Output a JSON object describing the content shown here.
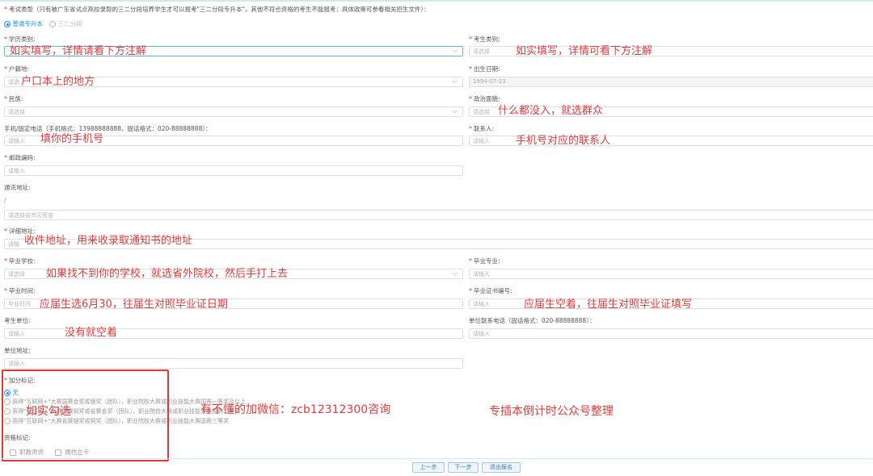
{
  "exam_type": {
    "label": "考试类型（只有被广东省试点高校录取的三二分段培养学生才可以报考\"三二分段专升本\"，其他不符合资格的考生不能报考：具体政策可参看相关招生文件）：",
    "options": [
      "普通专升本",
      "三二分段"
    ]
  },
  "fields": {
    "education_type": {
      "label": "学历类别:",
      "value": "如实填写，详情请看下方注解"
    },
    "candidate_type": {
      "label": "考生类别:",
      "placeholder": "请选择"
    },
    "household": {
      "label": "户籍地:",
      "placeholder": "请选"
    },
    "birth_date": {
      "label": "出生日期:",
      "value": "1994-07-23"
    },
    "ethnicity": {
      "label": "民族:",
      "placeholder": "请选择"
    },
    "political": {
      "label": "政治面貌:",
      "placeholder": "请选择"
    },
    "phone": {
      "label": "手机/固定电话（手机格式：13988888888，固话格式：020-88888888）：",
      "placeholder": "请输入"
    },
    "contact": {
      "label": "联系人:",
      "placeholder": "请输入"
    },
    "postcode": {
      "label": "邮政编码:",
      "placeholder": "请输入"
    },
    "address": {
      "label": "通讯地址:",
      "slash": "/",
      "placeholder": "请选择省市区街道"
    },
    "detail_address": {
      "label": "详细地址:",
      "placeholder": "请输"
    },
    "school": {
      "label": "毕业学校:",
      "placeholder": "请选择"
    },
    "major": {
      "label": "毕业专业:",
      "placeholder": "请输入"
    },
    "grad_time": {
      "label": "毕业时间:",
      "placeholder": "毕业时间"
    },
    "cert_no": {
      "label": "毕业证书编号:",
      "placeholder": "请输入"
    },
    "work_unit": {
      "label": "考生单位:",
      "placeholder": "请输入"
    },
    "unit_phone": {
      "label": "单位联系电话（固话格式：020-88888888）：",
      "placeholder": "请输入"
    },
    "unit_address": {
      "label": "单位地址:",
      "placeholder": "请输入"
    }
  },
  "bonus": {
    "label": "加分标记:",
    "options": [
      "无",
      "获得\"互联网+\"大赛国赛金奖或银奖（团队），职业院校大赛或职业技能大赛国赛一等奖及以上",
      "获得\"互联网+\"大赛国赛铜奖或省赛金奖（团队），职业院校大赛或职业技能大赛国赛二等奖",
      "获得\"互联网+\"大赛省赛银奖或铜奖（团队），职业院校大赛或职业技能大赛国赛三等奖"
    ]
  },
  "qualification": {
    "label": "资格标记:",
    "options": [
      "职教师资",
      "建档立卡"
    ]
  },
  "annotations": {
    "edu": "如实填写，详情请看下方注解",
    "candidate": "如实填写，详情可看下方注解",
    "household": "户口本上的地方",
    "political": "什么都没入，就选群众",
    "phone": "填你的手机号",
    "contact": "手机号对应的联系人",
    "detail_address": "收件地址，用来收录取通知书的地址",
    "school": "如果找不到你的学校，就选省外院校，然后手打上去",
    "grad_time": "应届生选6月30，往届生对照毕业证日期",
    "cert_no": "应届生空着，往届生对照毕业证填写",
    "work_unit": "没有就空着",
    "bonus": "如实勾选",
    "wechat": "有不懂的加微信：zcb12312300咨询",
    "credit": "专插本倒计时公众号整理"
  },
  "buttons": {
    "prev": "上一步",
    "next": "下一步",
    "exit": "退出报名"
  },
  "colors": {
    "accent": "#1890ff",
    "note": "#e23b3b",
    "required": "#e4393c"
  }
}
